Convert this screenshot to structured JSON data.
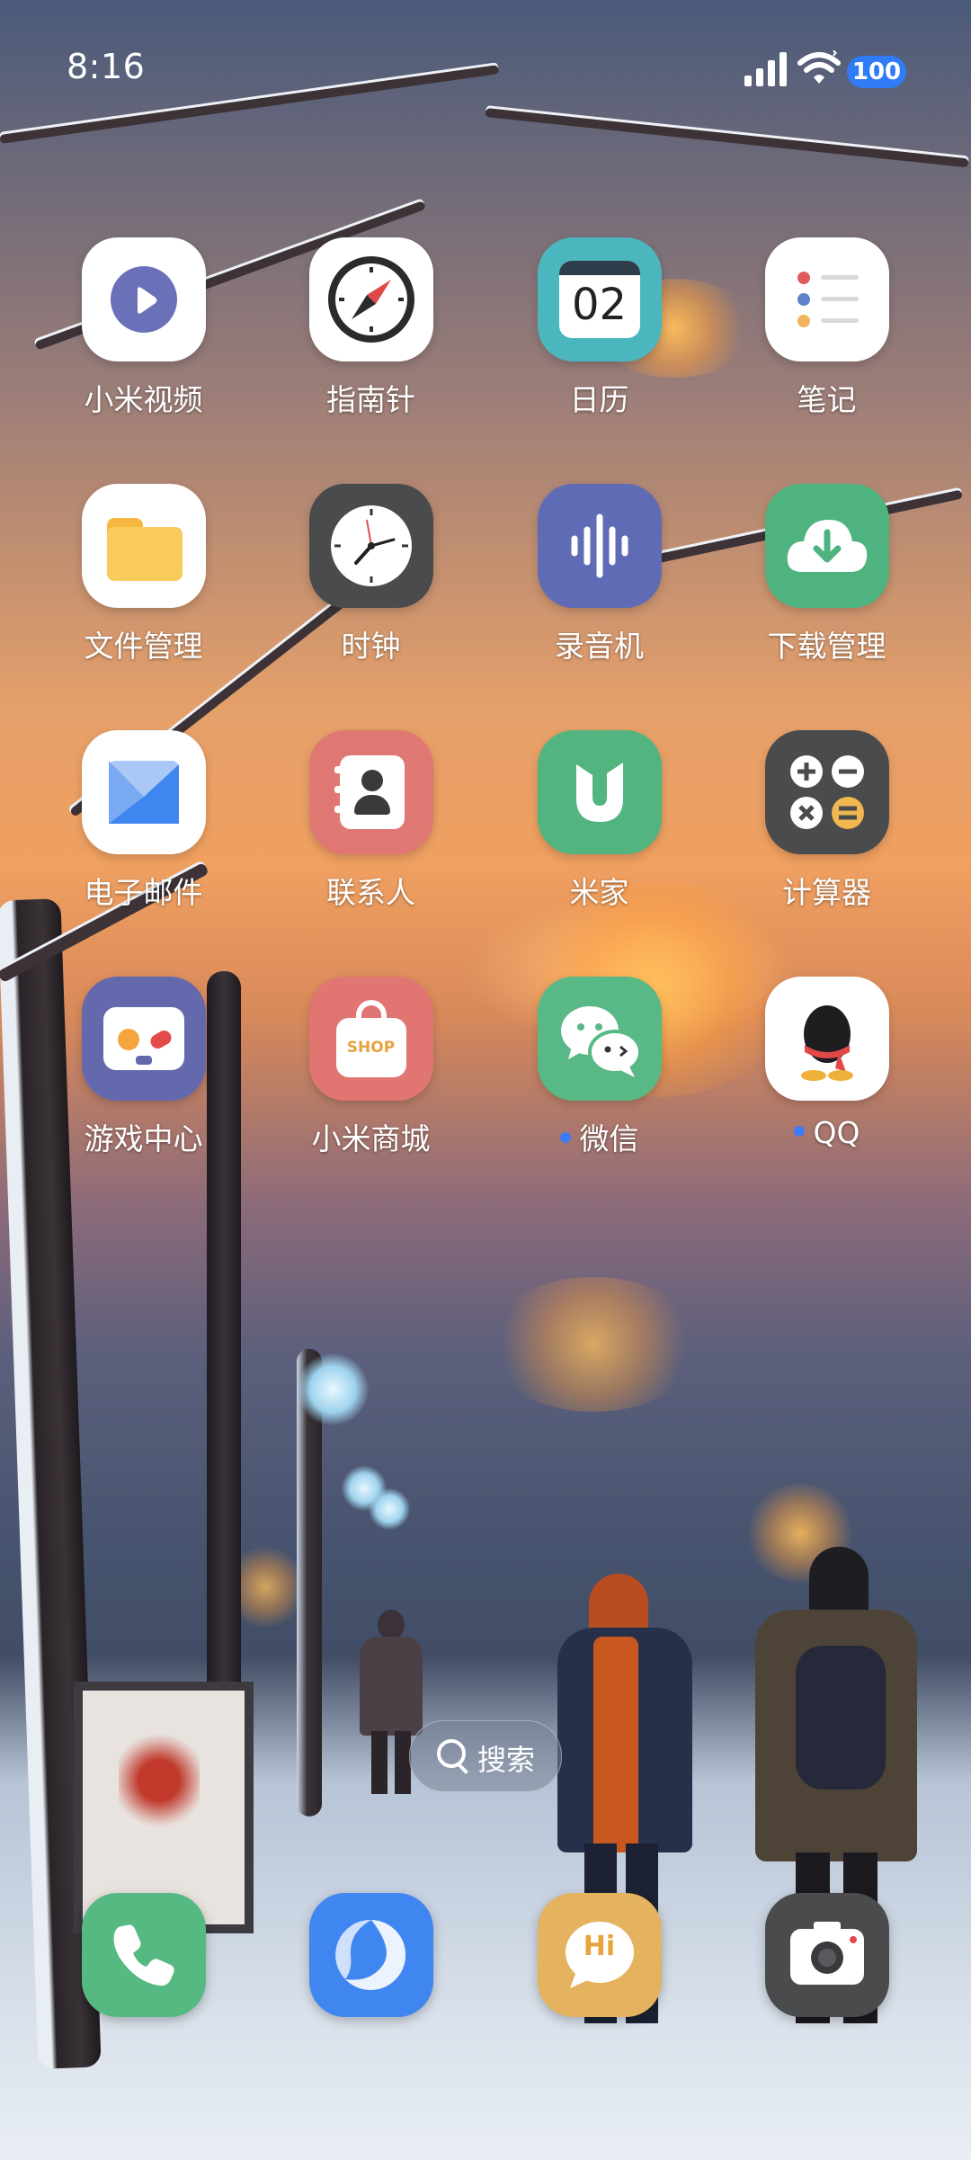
{
  "status_bar": {
    "time": "8:16",
    "battery": "100"
  },
  "apps": [
    {
      "label": "小米视频",
      "icon": "mi-video-icon"
    },
    {
      "label": "指南针",
      "icon": "compass-icon"
    },
    {
      "label": "日历",
      "icon": "calendar-icon",
      "icon_text": "02"
    },
    {
      "label": "笔记",
      "icon": "notes-icon"
    },
    {
      "label": "文件管理",
      "icon": "file-manager-icon"
    },
    {
      "label": "时钟",
      "icon": "clock-icon"
    },
    {
      "label": "录音机",
      "icon": "recorder-icon"
    },
    {
      "label": "下载管理",
      "icon": "download-manager-icon"
    },
    {
      "label": "电子邮件",
      "icon": "email-icon"
    },
    {
      "label": "联系人",
      "icon": "contacts-icon"
    },
    {
      "label": "米家",
      "icon": "mijia-icon"
    },
    {
      "label": "计算器",
      "icon": "calculator-icon"
    },
    {
      "label": "游戏中心",
      "icon": "game-center-icon"
    },
    {
      "label": "小米商城",
      "icon": "mi-store-icon",
      "icon_text": "SHOP"
    },
    {
      "label": "微信",
      "icon": "wechat-icon",
      "new_badge": true
    },
    {
      "label": "QQ",
      "icon": "qq-icon",
      "new_badge": true
    }
  ],
  "search": {
    "label": "搜索"
  },
  "dock": [
    {
      "icon": "phone-icon"
    },
    {
      "icon": "browser-icon"
    },
    {
      "icon": "messages-icon",
      "icon_text": "Hi"
    },
    {
      "icon": "camera-icon"
    }
  ],
  "colors": {
    "battery": "#2f7cf6",
    "badge_dot": "#3d7bf5",
    "video_icon": "#6a71b8",
    "calendar_icon": "#4bb6be",
    "recorder_icon": "#5f6cb5",
    "download_icon": "#4fb380",
    "contacts_icon": "#df7873",
    "mijia_icon": "#52b57f",
    "calculator_icon": "#4a4b4d",
    "game_icon": "#6469ad",
    "store_icon": "#e07571",
    "wechat_icon": "#59b986",
    "phone_icon": "#56b982",
    "browser_icon": "#3f86f1",
    "messages_icon": "#e5b25f",
    "camera_icon": "#4a4b4d"
  }
}
